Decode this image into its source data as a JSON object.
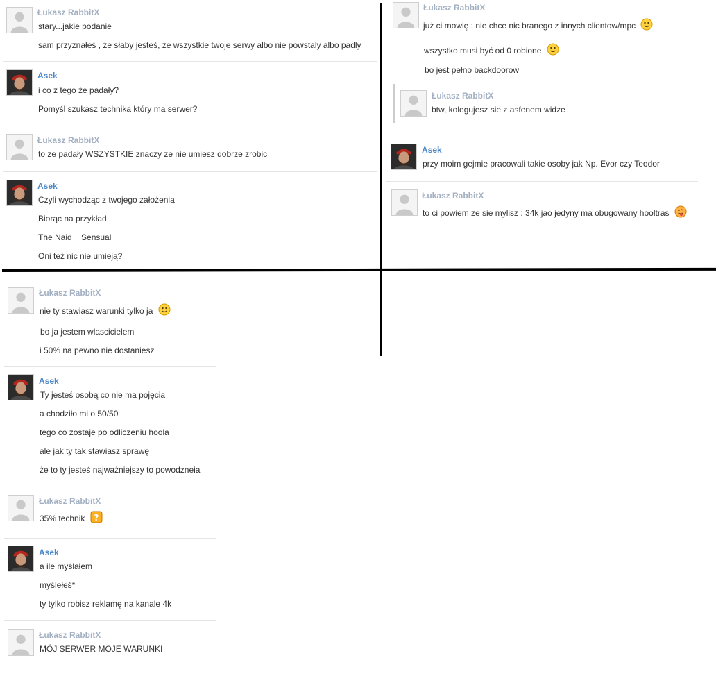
{
  "senders": {
    "lukasz": "Łukasz RabbitX",
    "asek": "Asek"
  },
  "panel_top_left": [
    {
      "sender": "lukasz",
      "lines": [
        "stary...jakie podanie",
        "sam przyznałeś , że słaby jesteś, że wszystkie twoje serwy albo nie powstaly albo padly"
      ]
    },
    {
      "sender": "asek",
      "lines": [
        "i co z tego że padały?",
        "Pomyśl szukasz technika który ma serwer?"
      ]
    },
    {
      "sender": "lukasz",
      "lines": [
        "to ze padały WSZYSTKIE znaczy ze nie umiesz dobrze zrobic"
      ]
    },
    {
      "sender": "asek",
      "lines": [
        "Czyli wychodząc z twojego założenia",
        "Biorąc na przykład",
        "The Naid    Sensual",
        "Oni też nic nie umieją?"
      ]
    }
  ],
  "panel_top_right": [
    {
      "sender": "lukasz",
      "lines": [
        "już ci mowię : nie chce nic branego z innych clientow/mpc",
        "wszystko musi być od 0 robione",
        "bo jest pełno backdoorow"
      ]
    },
    {
      "sender": "lukasz",
      "lines": [
        "btw, kolegujesz sie z asfenem widze"
      ]
    },
    {
      "sender": "asek",
      "lines": [
        "przy moim gejmie pracowali takie osoby jak Np. Evor czy Teodor"
      ]
    },
    {
      "sender": "lukasz",
      "lines": [
        "to ci powiem ze sie mylisz : 34k jao jedyny ma obugowany hooltras"
      ]
    }
  ],
  "panel_bottom": [
    {
      "sender": "lukasz",
      "lines": [
        "nie ty stawiasz warunki tylko ja",
        "bo ja jestem wlascicielem",
        "i 50% na pewno nie dostaniesz"
      ]
    },
    {
      "sender": "asek",
      "lines": [
        "Ty jesteś osobą co nie ma pojęcia",
        "a chodziło mi o 50/50",
        "tego co zostaje po odliczeniu hoola",
        "ale jak ty tak stawiasz sprawę",
        "że to ty jesteś najważniejszy to powodzneia"
      ]
    },
    {
      "sender": "lukasz",
      "lines": [
        "35% technik"
      ]
    },
    {
      "sender": "asek",
      "lines": [
        "a ile myślałem",
        "myślełeś*",
        "ty tylko robisz reklamę na kanale 4k"
      ]
    },
    {
      "sender": "lukasz",
      "lines": [
        "MÓJ SERWER MOJE WARUNKI"
      ]
    }
  ],
  "emoticons": {
    "smile": "smile-emoticon",
    "tongue": "tongue-emoticon",
    "question": "question-emoticon"
  },
  "colors": {
    "name_lukasz": "#a3b0c2",
    "name_asek": "#4d87c7",
    "text": "#333333",
    "divider": "#000000"
  }
}
